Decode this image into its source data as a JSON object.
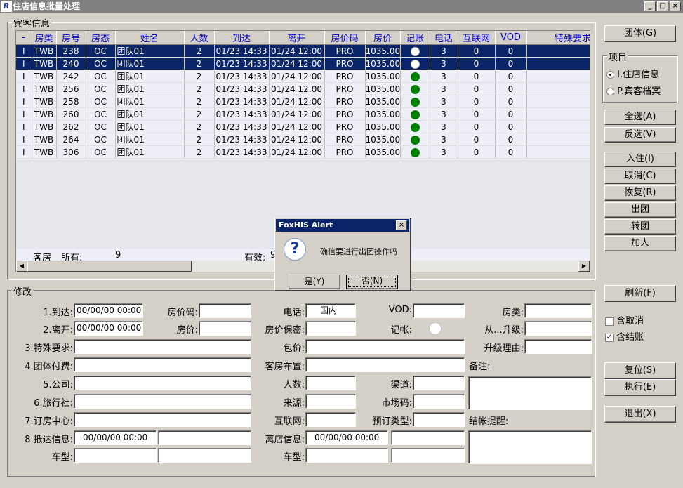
{
  "window": {
    "title": "住店信息批量处理",
    "logo": "R",
    "min": "_",
    "max": "□",
    "close": "×"
  },
  "guest_group": {
    "title": "宾客信息"
  },
  "table": {
    "headers": [
      "-",
      "房类",
      "房号",
      "房态",
      "姓名",
      "人数",
      "到达",
      "离开",
      "房价码",
      "房价",
      "记账",
      "电话",
      "互联网",
      "VOD",
      "特殊要求"
    ],
    "rows": [
      {
        "flag": "I",
        "type": "TWB",
        "room": "238",
        "status": "OC",
        "name": "团队01",
        "persons": "2",
        "arrive": "01/23 14:33",
        "depart": "01/24 12:00",
        "rate_code": "PRO",
        "rate": "1035.00",
        "post": "white",
        "phone": "3",
        "internet": "0",
        "vod": "0",
        "special": "",
        "selected": true
      },
      {
        "flag": "I",
        "type": "TWB",
        "room": "240",
        "status": "OC",
        "name": "团队01",
        "persons": "2",
        "arrive": "01/23 14:33",
        "depart": "01/24 12:00",
        "rate_code": "PRO",
        "rate": "1035.00",
        "post": "white",
        "phone": "3",
        "internet": "0",
        "vod": "0",
        "special": "",
        "selected": true
      },
      {
        "flag": "I",
        "type": "TWB",
        "room": "242",
        "status": "OC",
        "name": "团队01",
        "persons": "2",
        "arrive": "01/23 14:33",
        "depart": "01/24 12:00",
        "rate_code": "PRO",
        "rate": "1035.00",
        "post": "green",
        "phone": "3",
        "internet": "0",
        "vod": "0",
        "special": "",
        "selected": false
      },
      {
        "flag": "I",
        "type": "TWB",
        "room": "256",
        "status": "OC",
        "name": "团队01",
        "persons": "2",
        "arrive": "01/23 14:33",
        "depart": "01/24 12:00",
        "rate_code": "PRO",
        "rate": "1035.00",
        "post": "green",
        "phone": "3",
        "internet": "0",
        "vod": "0",
        "special": "",
        "selected": false
      },
      {
        "flag": "I",
        "type": "TWB",
        "room": "258",
        "status": "OC",
        "name": "团队01",
        "persons": "2",
        "arrive": "01/23 14:33",
        "depart": "01/24 12:00",
        "rate_code": "PRO",
        "rate": "1035.00",
        "post": "green",
        "phone": "3",
        "internet": "0",
        "vod": "0",
        "special": "",
        "selected": false
      },
      {
        "flag": "I",
        "type": "TWB",
        "room": "260",
        "status": "OC",
        "name": "团队01",
        "persons": "2",
        "arrive": "01/23 14:33",
        "depart": "01/24 12:00",
        "rate_code": "PRO",
        "rate": "1035.00",
        "post": "green",
        "phone": "3",
        "internet": "0",
        "vod": "0",
        "special": "",
        "selected": false
      },
      {
        "flag": "I",
        "type": "TWB",
        "room": "262",
        "status": "OC",
        "name": "团队01",
        "persons": "2",
        "arrive": "01/23 14:33",
        "depart": "01/24 12:00",
        "rate_code": "PRO",
        "rate": "1035.00",
        "post": "green",
        "phone": "3",
        "internet": "0",
        "vod": "0",
        "special": "",
        "selected": false
      },
      {
        "flag": "I",
        "type": "TWB",
        "room": "264",
        "status": "OC",
        "name": "团队01",
        "persons": "2",
        "arrive": "01/23 14:33",
        "depart": "01/24 12:00",
        "rate_code": "PRO",
        "rate": "1035.00",
        "post": "green",
        "phone": "3",
        "internet": "0",
        "vod": "0",
        "special": "",
        "selected": false
      },
      {
        "flag": "I",
        "type": "TWB",
        "room": "306",
        "status": "OC",
        "name": "团队01",
        "persons": "2",
        "arrive": "01/23 14:33",
        "depart": "01/24 12:00",
        "rate_code": "PRO",
        "rate": "1035.00",
        "post": "green",
        "phone": "3",
        "internet": "0",
        "vod": "0",
        "special": "",
        "selected": false
      }
    ],
    "summary": {
      "rooms_label": "客房",
      "all_label": "所有:",
      "all_count": "9",
      "valid_label": "有效:",
      "valid_count": "9"
    }
  },
  "right_panel": {
    "group_btn": "团体(G)",
    "items_title": "项目",
    "radio1": "I.住店信息",
    "radio2": "P.宾客档案",
    "select_all": "全选(A)",
    "invert": "反选(V)",
    "checkin": "入住(I)",
    "cancel": "取消(C)",
    "restore": "恢复(R)",
    "leave_group": "出团",
    "transfer": "转团",
    "join": "加人",
    "refresh": "刷新(F)",
    "include_cancel": "含取消",
    "include_checkout": "含结账",
    "reset": "复位(S)",
    "execute": "执行(E)",
    "exit": "退出(X)"
  },
  "modify": {
    "title": "修改",
    "arrive_label": "1.到达:",
    "arrive_value": "00/00/00 00:00",
    "depart_label": "2.离开:",
    "depart_value": "00/00/00 00:00",
    "special_label": "3.特殊要求:",
    "group_pay_label": "4.团体付费:",
    "company_label": "5.公司:",
    "agency_label": "6.旅行社:",
    "booking_label": "7.订房中心:",
    "arr_info_label": "8.抵达信息:",
    "arr_info_value": "00/00/00 00:00",
    "car_label": "车型:",
    "rate_code_label": "房价码:",
    "rate_label": "房价:",
    "phone_label": "电话:",
    "phone_value": "国内",
    "rate_keep_label": "房价保密:",
    "package_label": "包价:",
    "layout_label": "客房布置:",
    "persons_label": "人数:",
    "source_label": "来源:",
    "internet_label": "互联网:",
    "dep_info_label": "离店信息:",
    "dep_info_value": "00/00/00 00:00",
    "car2_label": "车型:",
    "vod_label": "VOD:",
    "post_label": "记帐:",
    "channel_label": "渠道:",
    "market_label": "市场码:",
    "booking_type_label": "预订类型:",
    "room_type_label": "房类:",
    "upgrade_label": "从...升级:",
    "upgrade_reason_label": "升级理由:",
    "remark_label": "备注:",
    "checkout_remind_label": "结帐提醒:"
  },
  "dialog": {
    "title": "FoxHIS Alert",
    "message": "确信要进行出团操作吗",
    "yes": "是(Y)",
    "no": "否(N)",
    "close": "×",
    "icon": "?"
  }
}
